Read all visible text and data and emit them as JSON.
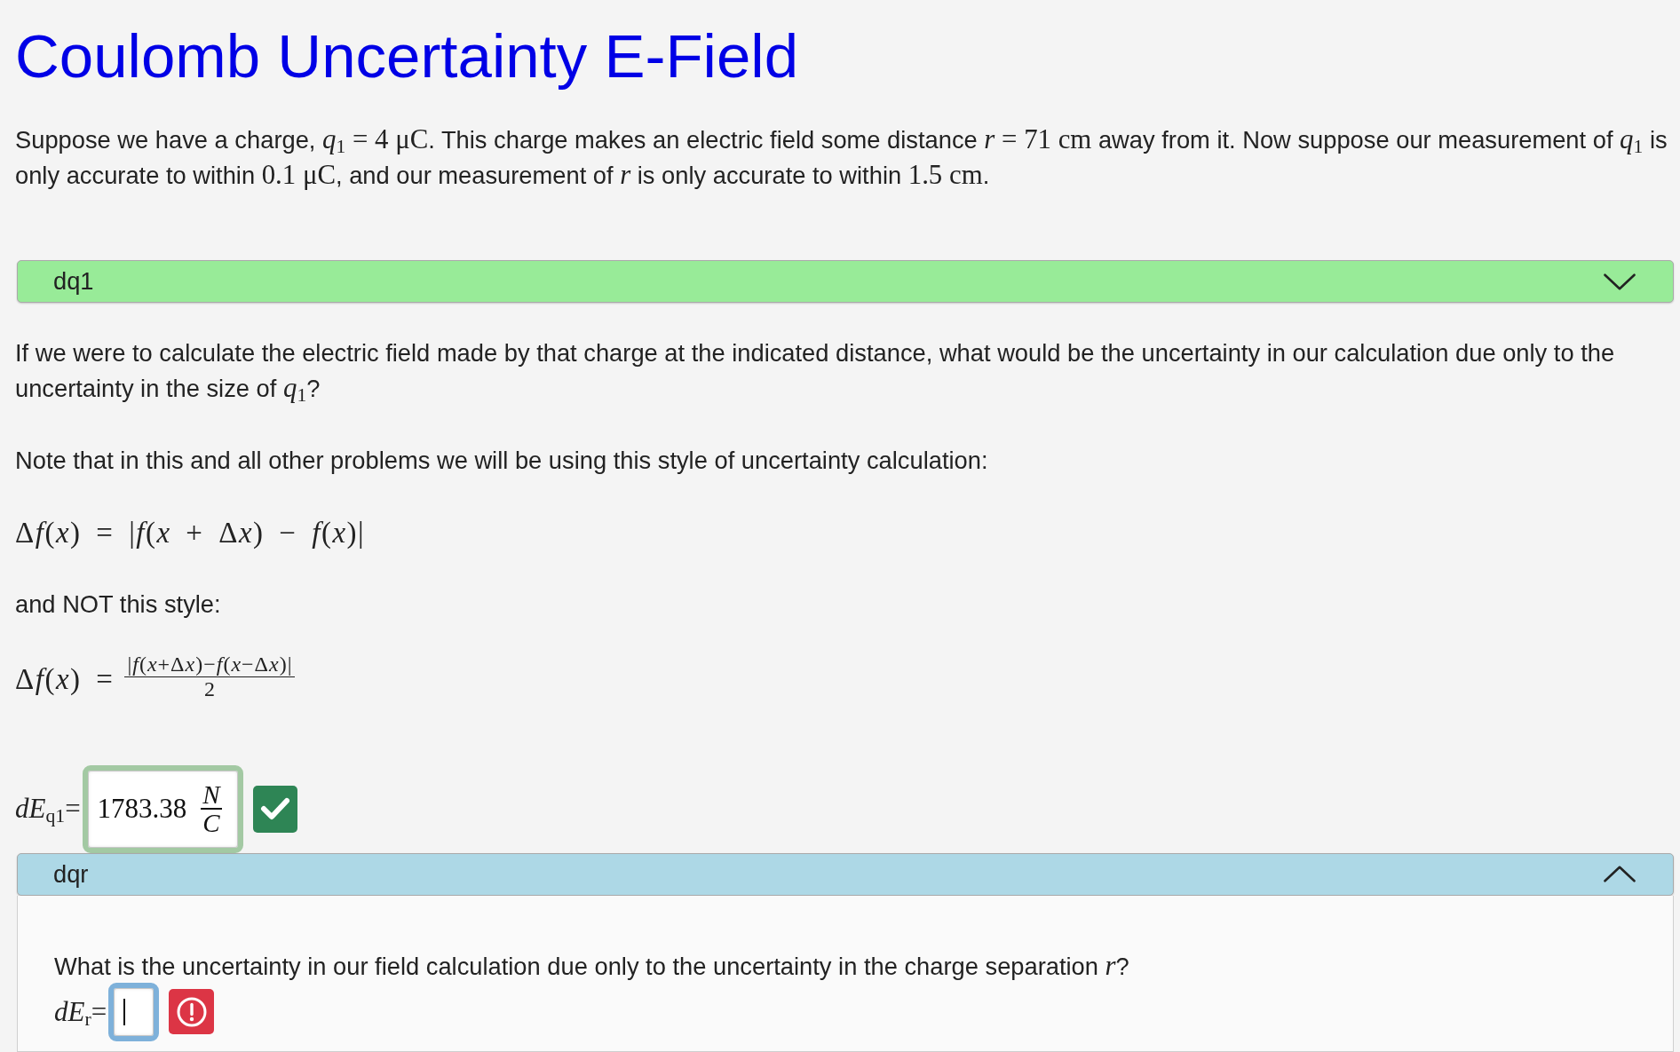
{
  "page": {
    "title": "Coulomb Uncertainty E-Field"
  },
  "intro": [
    {
      "kind": "text",
      "text": "Suppose we have a charge, "
    },
    {
      "kind": "math",
      "text": "*q*$_{1}$ = 4 μC"
    },
    {
      "kind": "text",
      "text": ". This charge makes an electric field some distance "
    },
    {
      "kind": "math",
      "text": "*r* = 71 cm"
    },
    {
      "kind": "text",
      "text": " away from it. Now suppose our measurement of "
    },
    {
      "kind": "math",
      "text": "*q*$_{1}$"
    },
    {
      "kind": "text",
      "text": " is only accurate to within "
    },
    {
      "kind": "math",
      "text": "0.1 μC"
    },
    {
      "kind": "text",
      "text": ", and our measurement of "
    },
    {
      "kind": "math",
      "text": "*r*"
    },
    {
      "kind": "text",
      "text": " is only accurate to within "
    },
    {
      "kind": "math",
      "text": "1.5 cm"
    },
    {
      "kind": "text",
      "text": "."
    }
  ],
  "sections": [
    {
      "title": "dq1",
      "expanded": false,
      "color": "#98eb98",
      "blocks": [
        {
          "kind": "paragraph",
          "segments": [
            {
              "kind": "text",
              "text": "If we were to calculate the electric field made by that charge at the indicated distance, what would be the uncertainty in our calculation due only to the uncertainty in the size of "
            },
            {
              "kind": "math",
              "text": "*q*$_{1}$"
            },
            {
              "kind": "text",
              "text": "?"
            }
          ]
        },
        {
          "kind": "paragraph",
          "segments": [
            {
              "kind": "text",
              "text": "Note that in this and all other problems we will be using this style of uncertainty calculation:"
            }
          ]
        },
        {
          "kind": "formula",
          "text": "Δf(x) = |f(x + Δx) − f(x)|"
        },
        {
          "kind": "paragraph",
          "segments": [
            {
              "kind": "text",
              "text": "and NOT this style:"
            }
          ]
        },
        {
          "kind": "fraction_formula",
          "lhs": "Δf(x) =",
          "numerator": "|f(x+Δx)−f(x−Δx)|",
          "denominator": "2"
        },
        {
          "kind": "answer",
          "label": "*dE*$_{q1}$=",
          "value": "1783.38",
          "unit_numerator": "N",
          "unit_denominator": "C",
          "correct": true,
          "focused": false
        }
      ]
    },
    {
      "title": "dqr",
      "expanded": true,
      "color": "#add8e6",
      "blocks": [
        {
          "kind": "paragraph",
          "segments": [
            {
              "kind": "text",
              "text": "What is the uncertainty in our field calculation due only to the uncertainty in the charge separation "
            },
            {
              "kind": "math",
              "text": "*r*"
            },
            {
              "kind": "text",
              "text": "?"
            }
          ]
        },
        {
          "kind": "answer",
          "label": "*dE*$_{r}$=",
          "correct": false,
          "focused": true
        }
      ]
    }
  ]
}
